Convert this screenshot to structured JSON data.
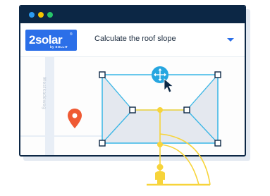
{
  "window": {
    "traffic_lights": [
      "#2b9bf2",
      "#f5c400",
      "#27c56a"
    ]
  },
  "brand": {
    "name": "2solar",
    "registered": "®",
    "byline": "by SOLLIT",
    "color": "#2b6fe8"
  },
  "toolbar": {
    "dropdown_label": "Calculate the roof slope",
    "dropdown_icon": "chevron-down-icon"
  },
  "map": {
    "street_name": "Westkadeweg",
    "pin_icon": "map-pin-icon",
    "pin_color": "#ef5a34"
  },
  "editor": {
    "selection_color": "#38b6e6",
    "roof_fill": "#e4e8ef",
    "move_handle_icon": "move-arrows-icon",
    "cursor_icon": "mouse-pointer-icon",
    "slope_indicator_color": "#f7d43a",
    "person_icon": "person-icon"
  }
}
